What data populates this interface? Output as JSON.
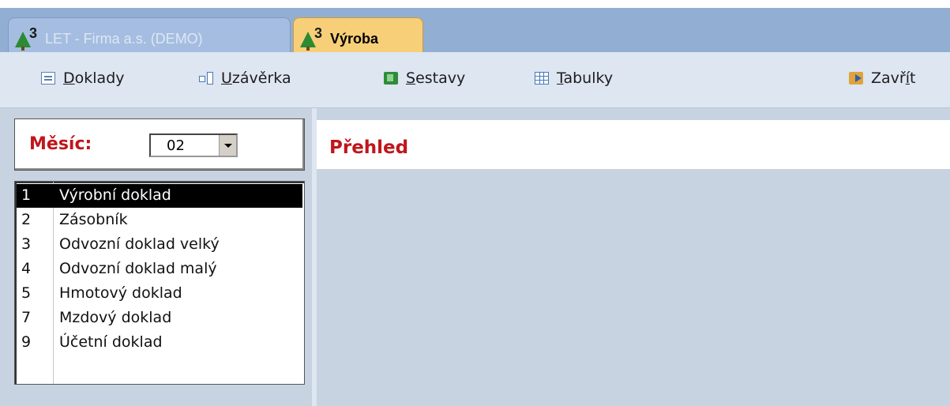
{
  "tabs": [
    {
      "number": "3",
      "label": "LET - Firma a.s. (DEMO)",
      "active": false
    },
    {
      "number": "3",
      "label": "Výroba",
      "active": true
    }
  ],
  "toolbar": {
    "doklady": {
      "u": "D",
      "rest": "oklady",
      "icon": "document-icon"
    },
    "uzaverka": {
      "u": "U",
      "rest": "závěrka",
      "icon": "hierarchy-icon"
    },
    "sestavy": {
      "u": "S",
      "rest": "estavy",
      "icon": "book-icon"
    },
    "tabulky": {
      "u": "T",
      "rest": "abulky",
      "icon": "table-icon"
    },
    "zavrit": {
      "pre": "Zavř",
      "u": "í",
      "rest": "t",
      "icon": "exit-door-icon"
    }
  },
  "month": {
    "label": "Měsíc:",
    "value": "02"
  },
  "documents": [
    {
      "num": "1",
      "name": "Výrobní doklad",
      "selected": true
    },
    {
      "num": "2",
      "name": "Zásobník",
      "selected": false
    },
    {
      "num": "3",
      "name": "Odvozní doklad velký",
      "selected": false
    },
    {
      "num": "4",
      "name": "Odvozní doklad malý",
      "selected": false
    },
    {
      "num": "5",
      "name": "Hmotový doklad",
      "selected": false
    },
    {
      "num": "7",
      "name": "Mzdový doklad",
      "selected": false
    },
    {
      "num": "9",
      "name": "Účetní doklad",
      "selected": false
    }
  ],
  "overview": {
    "title": "Přehled"
  },
  "colors": {
    "accent_red": "#c0161b",
    "tab_active": "#f7cf78",
    "tab_bar": "#93aed3",
    "panel_bg": "#c7d3e0"
  }
}
